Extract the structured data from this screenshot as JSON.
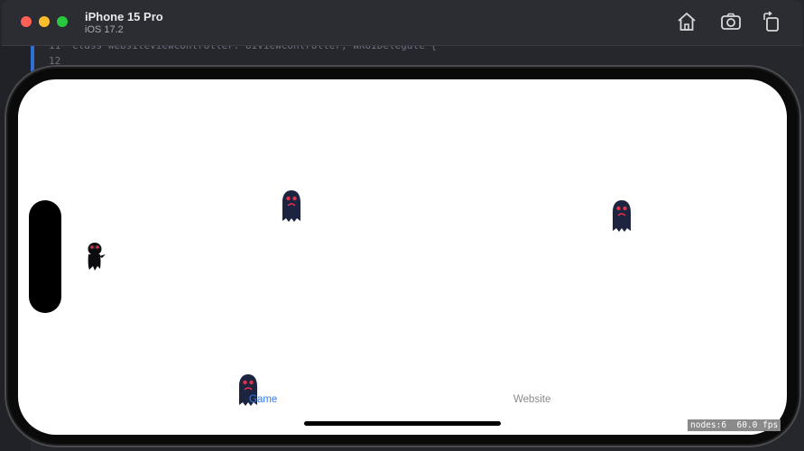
{
  "window": {
    "device_name": "iPhone 15 Pro",
    "os_version": "iOS 17.2",
    "toolbar_icons": [
      "home-icon",
      "screenshot-icon",
      "rotate-icon"
    ]
  },
  "background_code": {
    "line_11_number": "11",
    "line_11_text": "class WebsiteViewController: UIViewController, WKUIDelegate {",
    "line_12_number": "12"
  },
  "game": {
    "sprites": [
      "player-ninja",
      "ghost-enemy",
      "ghost-enemy",
      "ghost-enemy"
    ],
    "debug_overlay": "nodes:6  60.0 fps"
  },
  "tab_bar": {
    "tabs": [
      {
        "label": "Game",
        "selected": true,
        "color": "#2f7bf6"
      },
      {
        "label": "Website",
        "selected": false,
        "color": "#8a8a8f"
      }
    ]
  },
  "colors": {
    "accent": "#2f7bf6",
    "ghost_body": "#1c2440",
    "ghost_eyes": "#e0324b"
  }
}
